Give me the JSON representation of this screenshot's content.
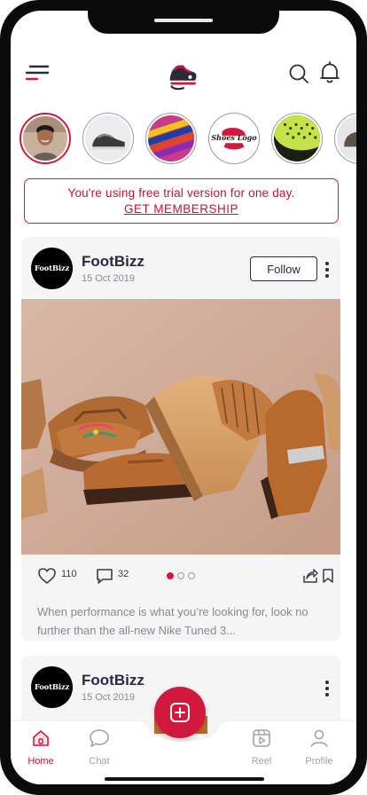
{
  "stories": [
    {
      "name": "story-user-1",
      "active": true
    },
    {
      "name": "story-shoe-1"
    },
    {
      "name": "story-fabric"
    },
    {
      "name": "story-shoes-logo",
      "logo_text": "Shoes Logo"
    },
    {
      "name": "story-mesh"
    },
    {
      "name": "story-shoe-2"
    }
  ],
  "trial_banner": {
    "message": "You're using free trial version for one day.",
    "link": "GET MEMBERSHIP"
  },
  "posts": [
    {
      "avatar_text": "FootBizz",
      "author": "FootBizz",
      "date": "15 Oct 2019",
      "follow_label": "Follow",
      "likes": "110",
      "comments": "32",
      "carousel": {
        "active_index": 0,
        "count": 3
      },
      "caption": "When performance is what you’re looking for, look no further than the all-new Nike Tuned 3..."
    },
    {
      "avatar_text": "FootBizz",
      "author": "FootBizz",
      "date": "15 Oct 2019"
    }
  ],
  "bottom_nav": {
    "items": [
      {
        "label": "Home",
        "active": true,
        "icon": "home-icon"
      },
      {
        "label": "Chat",
        "icon": "chat-icon"
      },
      {
        "label": "Reel",
        "icon": "reel-icon"
      },
      {
        "label": "Profile",
        "icon": "profile-icon"
      }
    ],
    "fab_icon": "add-post-icon"
  },
  "colors": {
    "accent": "#d3183d",
    "text_dark": "#2a2a40",
    "card_bg": "#f5f5f6"
  }
}
